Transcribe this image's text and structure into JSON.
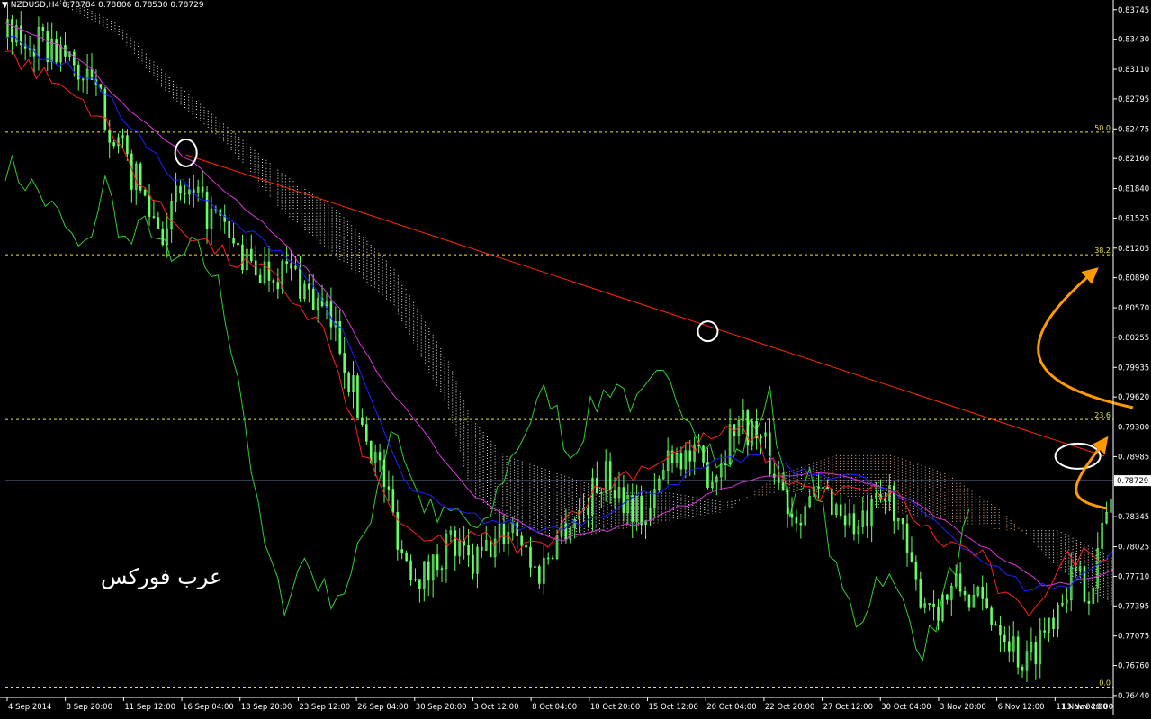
{
  "header": {
    "symbol_label": "NZDUSD,H4",
    "ohlc": "0.78784 0.78806 0.78530 0.78729"
  },
  "watermark_text": "عرب فوركس",
  "colors": {
    "background": "#000000",
    "candles": "#66ff66",
    "chikou": "#33cc33",
    "tenkan": "#ff2020",
    "kijun": "#2020ff",
    "ma": "#dd33dd",
    "trendline": "#ff2a00",
    "fib": "#e5e54c",
    "price_line": "#8899cc",
    "cloud_bear": "#e8e8e8",
    "cloud_bull": "#e8b08a",
    "circles": "#ffffff",
    "arrows": "#ff9900",
    "axis_text": "#ffffff"
  },
  "chart_data": {
    "type": "candlestick",
    "symbol": "NZDUSD",
    "timeframe": "H4",
    "current_price": "0.78729",
    "y_ticks": [
      "0.83745",
      "0.83430",
      "0.83110",
      "0.82795",
      "0.82475",
      "0.82160",
      "0.81840",
      "0.81525",
      "0.81205",
      "0.80890",
      "0.80570",
      "0.80255",
      "0.79935",
      "0.79620",
      "0.79300",
      "0.78985",
      "0.78345",
      "0.78025",
      "0.77710",
      "0.77395",
      "0.77075",
      "0.76760",
      "0.76440"
    ],
    "ylim": [
      0.7642,
      0.8381
    ],
    "x_ticks": [
      "4 Sep 2014",
      "8 Sep 20:00",
      "11 Sep 12:00",
      "16 Sep 04:00",
      "18 Sep 20:00",
      "23 Sep 12:00",
      "26 Sep 04:00",
      "30 Sep 20:00",
      "3 Oct 12:00",
      "8 Oct 04:00",
      "10 Oct 20:00",
      "15 Oct 12:00",
      "20 Oct 04:00",
      "22 Oct 20:00",
      "27 Oct 12:00",
      "30 Oct 04:00",
      "3 Nov 20:00",
      "6 Nov 12:00",
      "11 Nov 04:00",
      "13 Nov 20:00"
    ],
    "fibonacci": [
      {
        "label": "50.0",
        "price": 0.8244
      },
      {
        "label": "38.2",
        "price": 0.81135
      },
      {
        "label": "23.6",
        "price": 0.7938
      },
      {
        "label": "0.0",
        "price": 0.7653
      }
    ],
    "close_path": [
      [
        0,
        0.8345
      ],
      [
        5,
        0.833
      ],
      [
        8,
        0.829
      ],
      [
        11,
        0.821
      ],
      [
        14,
        0.814
      ],
      [
        16,
        0.818
      ],
      [
        19,
        0.815
      ],
      [
        22,
        0.81
      ],
      [
        26,
        0.8095
      ],
      [
        30,
        0.803
      ],
      [
        32,
        0.794
      ],
      [
        34,
        0.788
      ],
      [
        36,
        0.779
      ],
      [
        38,
        0.777
      ],
      [
        40,
        0.781
      ],
      [
        42,
        0.778
      ],
      [
        46,
        0.783
      ],
      [
        48,
        0.777
      ],
      [
        50,
        0.782
      ],
      [
        52,
        0.784
      ],
      [
        54,
        0.788
      ],
      [
        58,
        0.783
      ],
      [
        60,
        0.791
      ],
      [
        64,
        0.788
      ],
      [
        66,
        0.794
      ],
      [
        68,
        0.792
      ],
      [
        71,
        0.784
      ],
      [
        74,
        0.786
      ],
      [
        77,
        0.782
      ],
      [
        80,
        0.786
      ],
      [
        82,
        0.776
      ],
      [
        84,
        0.774
      ],
      [
        86,
        0.776
      ],
      [
        88,
        0.774
      ],
      [
        90,
        0.772
      ],
      [
        92,
        0.7675
      ],
      [
        94,
        0.772
      ],
      [
        96,
        0.777
      ],
      [
        98,
        0.776
      ],
      [
        100,
        0.787
      ]
    ],
    "tenkan": [
      [
        0,
        0.833
      ],
      [
        8,
        0.827
      ],
      [
        14,
        0.816
      ],
      [
        20,
        0.811
      ],
      [
        24,
        0.809
      ],
      [
        29,
        0.803
      ],
      [
        31,
        0.794
      ],
      [
        34,
        0.786
      ],
      [
        37,
        0.7805
      ],
      [
        40,
        0.781
      ],
      [
        44,
        0.781
      ],
      [
        48,
        0.78
      ],
      [
        52,
        0.785
      ],
      [
        56,
        0.788
      ],
      [
        60,
        0.79
      ],
      [
        64,
        0.792
      ],
      [
        67,
        0.7925
      ],
      [
        70,
        0.788
      ],
      [
        73,
        0.786
      ],
      [
        76,
        0.786
      ],
      [
        80,
        0.786
      ],
      [
        84,
        0.781
      ],
      [
        88,
        0.7795
      ],
      [
        90,
        0.775
      ],
      [
        92,
        0.773
      ],
      [
        94,
        0.776
      ],
      [
        96,
        0.779
      ],
      [
        100,
        0.78
      ]
    ],
    "kijun": [
      [
        0,
        0.8345
      ],
      [
        8,
        0.83
      ],
      [
        14,
        0.821
      ],
      [
        20,
        0.815
      ],
      [
        26,
        0.811
      ],
      [
        30,
        0.804
      ],
      [
        33,
        0.796
      ],
      [
        36,
        0.787
      ],
      [
        40,
        0.784
      ],
      [
        44,
        0.783
      ],
      [
        48,
        0.782
      ],
      [
        52,
        0.783
      ],
      [
        56,
        0.785
      ],
      [
        60,
        0.787
      ],
      [
        64,
        0.789
      ],
      [
        68,
        0.79
      ],
      [
        72,
        0.788
      ],
      [
        76,
        0.788
      ],
      [
        80,
        0.786
      ],
      [
        84,
        0.783
      ],
      [
        88,
        0.779
      ],
      [
        92,
        0.776
      ],
      [
        96,
        0.776
      ],
      [
        100,
        0.78
      ]
    ],
    "moving_average": [
      [
        0,
        0.836
      ],
      [
        6,
        0.833
      ],
      [
        12,
        0.826
      ],
      [
        18,
        0.82
      ],
      [
        24,
        0.814
      ],
      [
        30,
        0.806
      ],
      [
        34,
        0.798
      ],
      [
        38,
        0.792
      ],
      [
        42,
        0.786
      ],
      [
        46,
        0.783
      ],
      [
        50,
        0.781
      ],
      [
        54,
        0.782
      ],
      [
        58,
        0.783
      ],
      [
        62,
        0.785
      ],
      [
        66,
        0.787
      ],
      [
        70,
        0.788
      ],
      [
        74,
        0.788
      ],
      [
        78,
        0.787
      ],
      [
        82,
        0.785
      ],
      [
        86,
        0.782
      ],
      [
        90,
        0.779
      ],
      [
        94,
        0.776
      ],
      [
        98,
        0.777
      ],
      [
        100,
        0.778
      ]
    ],
    "chikou": [
      [
        0,
        0.821
      ],
      [
        3,
        0.818
      ],
      [
        5,
        0.815
      ],
      [
        7,
        0.811
      ],
      [
        9,
        0.819
      ],
      [
        11,
        0.812
      ],
      [
        13,
        0.815
      ],
      [
        15,
        0.81
      ],
      [
        17,
        0.812
      ],
      [
        19,
        0.809
      ],
      [
        21,
        0.799
      ],
      [
        23,
        0.782
      ],
      [
        25,
        0.774
      ],
      [
        27,
        0.779
      ],
      [
        29,
        0.775
      ],
      [
        31,
        0.776
      ],
      [
        33,
        0.784
      ],
      [
        35,
        0.794
      ],
      [
        37,
        0.786
      ],
      [
        39,
        0.783
      ],
      [
        41,
        0.784
      ],
      [
        43,
        0.781
      ],
      [
        45,
        0.788
      ],
      [
        47,
        0.793
      ],
      [
        49,
        0.797
      ],
      [
        51,
        0.79
      ],
      [
        53,
        0.795
      ],
      [
        55,
        0.798
      ],
      [
        57,
        0.795
      ],
      [
        59,
        0.798
      ],
      [
        61,
        0.796
      ],
      [
        63,
        0.792
      ],
      [
        65,
        0.788
      ],
      [
        67,
        0.792
      ],
      [
        69,
        0.796
      ],
      [
        71,
        0.784
      ],
      [
        73,
        0.788
      ],
      [
        75,
        0.777
      ],
      [
        77,
        0.772
      ],
      [
        79,
        0.778
      ],
      [
        81,
        0.774
      ],
      [
        83,
        0.769
      ],
      [
        85,
        0.776
      ],
      [
        87,
        0.783
      ]
    ],
    "cloud_a": [
      [
        5,
        0.839
      ],
      [
        10,
        0.836
      ],
      [
        15,
        0.83
      ],
      [
        20,
        0.825
      ],
      [
        25,
        0.82
      ],
      [
        30,
        0.816
      ],
      [
        35,
        0.81
      ],
      [
        40,
        0.8
      ],
      [
        42,
        0.794
      ],
      [
        45,
        0.79
      ],
      [
        50,
        0.788
      ],
      [
        55,
        0.786
      ],
      [
        60,
        0.786
      ],
      [
        65,
        0.785
      ],
      [
        70,
        0.786
      ],
      [
        75,
        0.786
      ],
      [
        80,
        0.784
      ],
      [
        85,
        0.783
      ],
      [
        90,
        0.782
      ],
      [
        95,
        0.782
      ],
      [
        100,
        0.779
      ]
    ],
    "cloud_b": [
      [
        5,
        0.838
      ],
      [
        10,
        0.835
      ],
      [
        15,
        0.828
      ],
      [
        20,
        0.823
      ],
      [
        25,
        0.816
      ],
      [
        30,
        0.811
      ],
      [
        35,
        0.806
      ],
      [
        40,
        0.795
      ],
      [
        42,
        0.786
      ],
      [
        45,
        0.783
      ],
      [
        50,
        0.781
      ],
      [
        55,
        0.782
      ],
      [
        60,
        0.783
      ],
      [
        65,
        0.784
      ],
      [
        70,
        0.788
      ],
      [
        75,
        0.79
      ],
      [
        80,
        0.79
      ],
      [
        85,
        0.788
      ],
      [
        90,
        0.784
      ],
      [
        95,
        0.778
      ],
      [
        100,
        0.774
      ]
    ],
    "trendline": [
      [
        16.3,
        0.822
      ],
      [
        99.2,
        0.7899
      ]
    ],
    "annotations": [
      "circle: Sep 16 touch",
      "circle: Oct 20 touch",
      "circle: Nov 13 test",
      "arrow: curved up right",
      "arrow: curved up short"
    ]
  }
}
